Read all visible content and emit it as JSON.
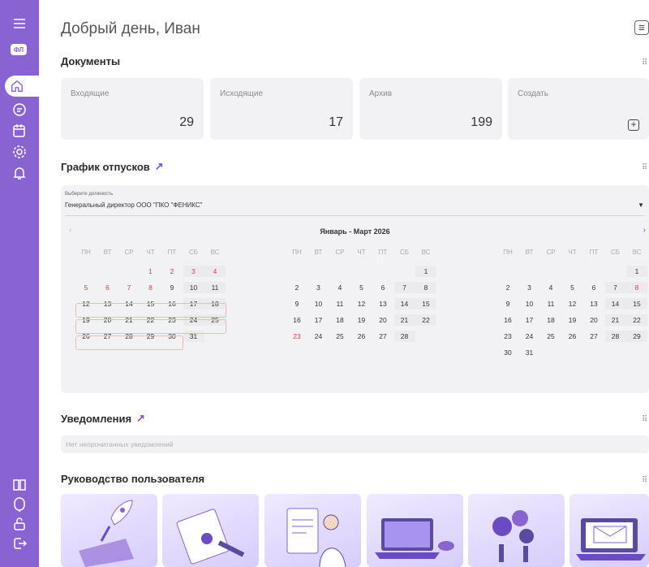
{
  "greeting": "Добрый день, Иван",
  "sidebar": {
    "badge": "ФЛ"
  },
  "documents": {
    "title": "Документы",
    "cards": [
      {
        "label": "Входящие",
        "count": "29"
      },
      {
        "label": "Исходящие",
        "count": "17"
      },
      {
        "label": "Архив",
        "count": "199"
      },
      {
        "label": "Создать",
        "count": ""
      }
    ]
  },
  "vacations": {
    "title": "График отпусков",
    "position_label": "Выберите должность",
    "position_value": "Генеральный директор ООО \"ПКО \"ФЕНИКС\"",
    "period": "Январь - Март 2026",
    "weekdays": [
      "ПН",
      "ВТ",
      "СР",
      "ЧТ",
      "ПТ",
      "СБ",
      "ВС"
    ]
  },
  "notifications": {
    "title": "Уведомления",
    "empty": "Нет непрочитанных уведомлений"
  },
  "guide": {
    "title": "Руководство пользователя"
  },
  "colors": {
    "accent": "#8a63d2",
    "holiday": "#e0393e",
    "panel": "#f2f2f4"
  }
}
